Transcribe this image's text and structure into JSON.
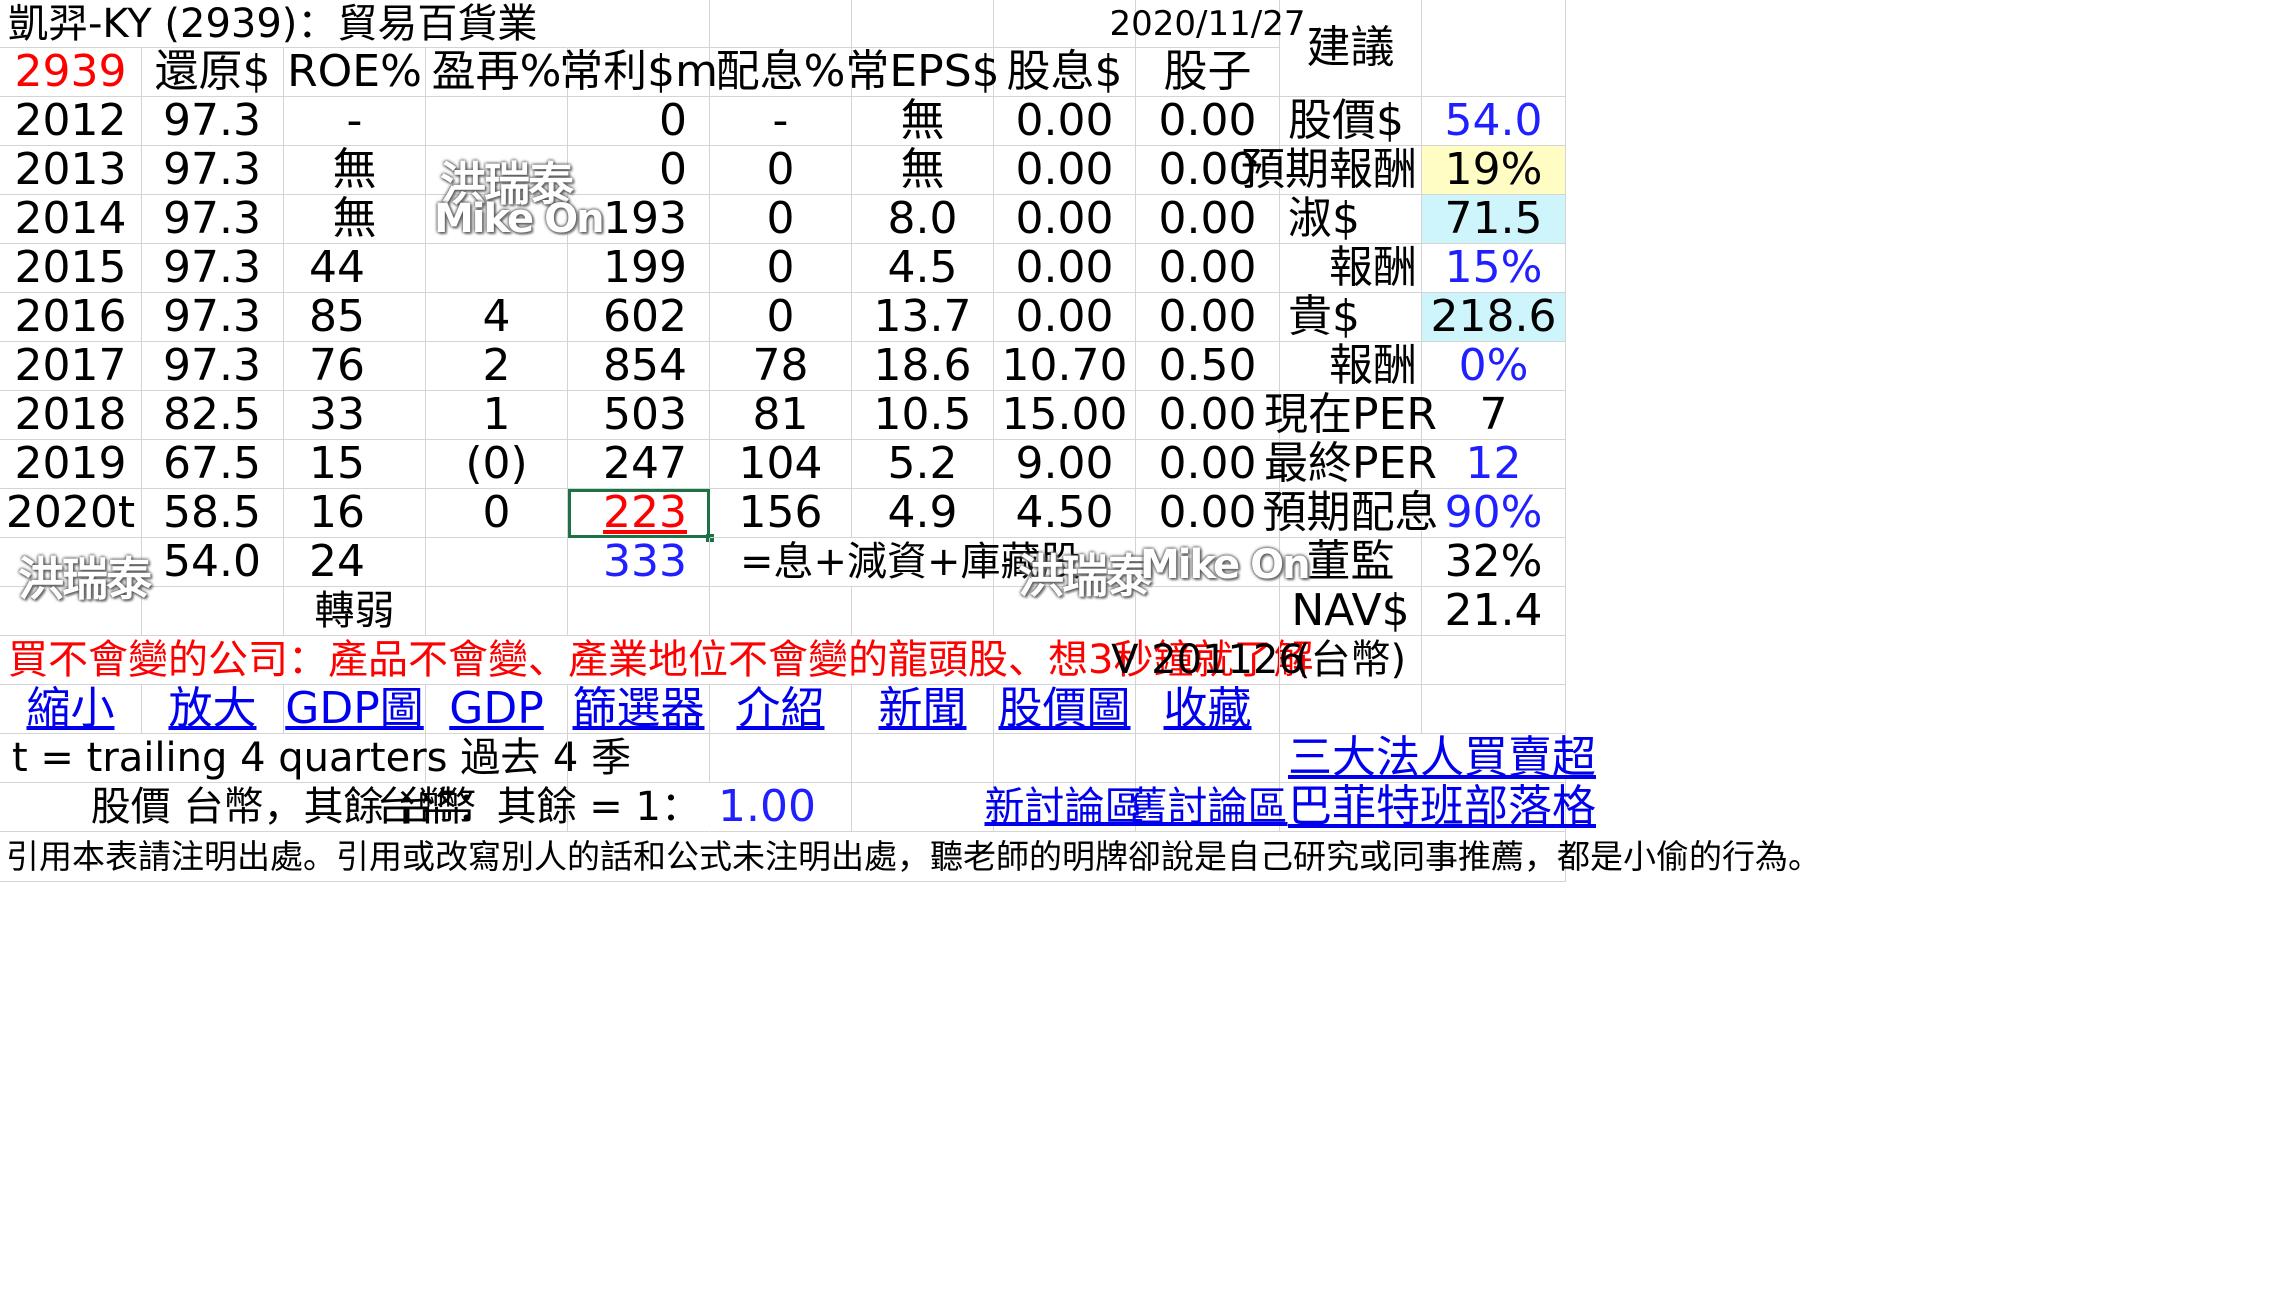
{
  "header": {
    "title": "凱羿-KY (2939)：貿易百貨業",
    "date": "2020/11/27",
    "suggest_label": "建議"
  },
  "columns": {
    "code": "2939",
    "restore": "還原$",
    "roe": "ROE%",
    "reinvest": "盈再%",
    "profit": "常利$m",
    "payout": "配息%",
    "eps": "常EPS$",
    "dividend": "股息$",
    "stock_div": "股子"
  },
  "rows": [
    {
      "year": "2012",
      "restore": "97.3",
      "roe": "-",
      "reinvest": "",
      "profit": "0",
      "payout": "-",
      "eps": "無",
      "dividend": "0.00",
      "stock_div": "0.00"
    },
    {
      "year": "2013",
      "restore": "97.3",
      "roe": "無",
      "reinvest": "",
      "profit": "0",
      "payout": "0",
      "eps": "無",
      "dividend": "0.00",
      "stock_div": "0.00"
    },
    {
      "year": "2014",
      "restore": "97.3",
      "roe": "無",
      "reinvest": "",
      "profit": "193",
      "payout": "0",
      "eps": "8.0",
      "dividend": "0.00",
      "stock_div": "0.00"
    },
    {
      "year": "2015",
      "restore": "97.3",
      "roe": "44",
      "reinvest": "",
      "profit": "199",
      "payout": "0",
      "eps": "4.5",
      "dividend": "0.00",
      "stock_div": "0.00"
    },
    {
      "year": "2016",
      "restore": "97.3",
      "roe": "85",
      "reinvest": "4",
      "profit": "602",
      "payout": "0",
      "eps": "13.7",
      "dividend": "0.00",
      "stock_div": "0.00"
    },
    {
      "year": "2017",
      "restore": "97.3",
      "roe": "76",
      "reinvest": "2",
      "profit": "854",
      "payout": "78",
      "eps": "18.6",
      "dividend": "10.70",
      "stock_div": "0.50"
    },
    {
      "year": "2018",
      "restore": "82.5",
      "roe": "33",
      "reinvest": "1",
      "profit": "503",
      "payout": "81",
      "eps": "10.5",
      "dividend": "15.00",
      "stock_div": "0.00"
    },
    {
      "year": "2019",
      "restore": "67.5",
      "roe": "15",
      "reinvest": "(0)",
      "profit": "247",
      "payout": "104",
      "eps": "5.2",
      "dividend": "9.00",
      "stock_div": "0.00"
    },
    {
      "year": "2020t",
      "restore": "58.5",
      "roe": "16",
      "reinvest": "0",
      "profit": "223",
      "payout": "156",
      "eps": "4.9",
      "dividend": "4.50",
      "stock_div": "0.00"
    }
  ],
  "summary": {
    "restore": "54.0",
    "roe": "24",
    "profit": "333",
    "note": "=息+減資+庫藏股",
    "trend": "轉弱"
  },
  "side": {
    "price_label": "股價$",
    "price": "54.0",
    "expected_return_label": "預期報酬",
    "expected_return": "19%",
    "cheap_label": "淑$",
    "cheap": "71.5",
    "cheap_return_label": "報酬",
    "cheap_return": "15%",
    "expensive_label": "貴$",
    "expensive": "218.6",
    "expensive_return_label": "報酬",
    "expensive_return": "0%",
    "per_now_label": "現在PER",
    "per_now": "7",
    "per_final_label": "最終PER",
    "per_final": "12",
    "payout_expected_label": "預期配息",
    "payout_expected": "90%",
    "directors_label": "董監",
    "directors": "32%",
    "nav_label": "NAV$",
    "nav": "21.4",
    "currency": "(台幣)"
  },
  "slogan": "買不會變的公司：產品不會變、產業地位不會變的龍頭股、想3秒鐘就了解",
  "version": "V 201126",
  "links": {
    "shrink": "縮小",
    "enlarge": "放大",
    "gdp_chart": "GDP圖",
    "gdp": "GDP",
    "screener": "篩選器",
    "intro": "介紹",
    "news": "新聞",
    "price_chart": "股價圖",
    "favorite": "收藏",
    "institutional": "三大法人買賣超",
    "new_forum": "新討論區",
    "old_forum": "舊討論區",
    "buffett_blog": "巴菲特班部落格"
  },
  "footnote": {
    "trailing": "t = trailing 4 quarters 過去 4 季",
    "currency_note": "股價 台幣，其餘 台幣",
    "fx_label": "台幣：其餘 = 1：",
    "fx_value": "1.00",
    "citation": "引用本表請注明出處。引用或改寫別人的話和公式未注明出處，聽老師的明牌卻說是自己研究或同事推薦，都是小偷的行為。"
  },
  "watermarks": {
    "name": "洪瑞泰",
    "brand": "Mike On"
  },
  "colors": {
    "accent_red": "#ff0000",
    "accent_blue": "#1f1fff",
    "link_blue": "#0000ee",
    "highlight_yellow": "#fffdc4",
    "highlight_cyan": "#cdf5fb",
    "selection_green": "#1e7145"
  }
}
